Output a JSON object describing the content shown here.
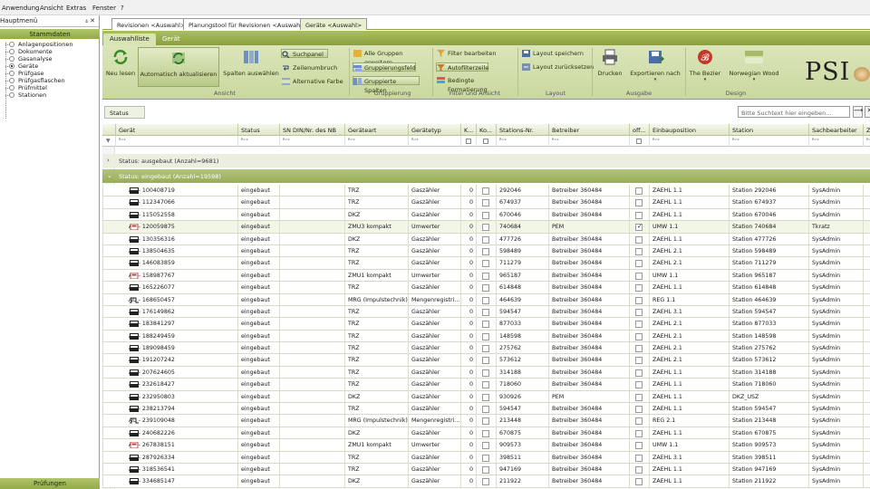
{
  "menu": [
    "Anwendung",
    "Ansicht",
    "Extras",
    "Fenster",
    "?"
  ],
  "left": {
    "title": "Hauptmenü",
    "controls": "₄ ✕",
    "header": "Stammdaten",
    "footer": "Prüfungen",
    "items": [
      {
        "label": "Anlagenpositionen",
        "selected": false
      },
      {
        "label": "Dokumente",
        "selected": false
      },
      {
        "label": "Gasanalyse",
        "selected": false
      },
      {
        "label": "Geräte",
        "selected": true
      },
      {
        "label": "Prüfgase",
        "selected": false
      },
      {
        "label": "Prüfgasflaschen",
        "selected": false
      },
      {
        "label": "Prüfmittel",
        "selected": false
      },
      {
        "label": "Stationen",
        "selected": false
      }
    ]
  },
  "doc_tabs": [
    "Revisionen <Auswahl>",
    "Planungstool für Revisionen <Auswahl>",
    "Geräte <Auswahl>"
  ],
  "ribbon_tabs": [
    "Auswahlliste",
    "Gerät"
  ],
  "ribbon": {
    "neu_lesen": "Neu lesen",
    "auto": "Automatisch aktualisieren",
    "spalten": "Spalten auswählen",
    "suchpanel": "Suchpanel",
    "zeilenumbruch": "Zeilenumbruch",
    "alternative": "Alternative Farbe",
    "alle_gruppen": "Alle Gruppen erweitern",
    "gruppierungsfeld": "Gruppierungsfeld",
    "gruppierte": "Gruppierte Spalten",
    "filter_bearb": "Filter bearbeiten",
    "autofilter": "Autofilterzeile",
    "bedingte": "Bedingte Formatierung",
    "layout_speichern": "Layout speichern",
    "layout_zurueck": "Layout zurücksetzen",
    "drucken": "Drucken",
    "exportieren": "Exportieren nach",
    "bezier": "The Bezier",
    "norwegian": "Norwegian Wood",
    "groups": [
      "Ansicht",
      "Gruppierung",
      "Filter und Ansicht",
      "Layout",
      "Ausgabe",
      "Design"
    ],
    "logo": "PSI"
  },
  "group_panel": {
    "chip": "Status",
    "search_placeholder": "Bitte Suchtext hier eingeben...",
    "btn1": "⟶",
    "btn2": "✕"
  },
  "columns": [
    "Gerät",
    "Status",
    "SN DIN/Nr. des NB",
    "Geräteart",
    "Gerätetyp",
    "K...",
    "Ko...",
    "Stations-Nr.",
    "Betreiber",
    "off...",
    "Einbauposition",
    "Station",
    "Sachbearbeiter",
    "Ze"
  ],
  "filter_marker": "▼",
  "filter_glyph": "ᴿ⁼ᶜ",
  "groups": [
    {
      "label": "Status: ausgebaut (Anzahl=9681)",
      "arrow": "›"
    },
    {
      "label": "Status: eingebaut (Anzahl=19598)",
      "arrow": "⌄"
    }
  ],
  "rows": [
    {
      "icon": "meter",
      "geraet": "AC - 100408719",
      "status": "eingebaut",
      "art": "TRZ",
      "typ": "Gaszähler",
      "k": "0",
      "nr": "292046",
      "betreiber": "Betreiber 360484",
      "off": false,
      "pos": "ZAEHL 1.1",
      "station": "Station 292046",
      "sb": "SysAdmin"
    },
    {
      "icon": "meter",
      "geraet": "AC - 112347066",
      "status": "eingebaut",
      "art": "TRZ",
      "typ": "Gaszähler",
      "k": "0",
      "nr": "674937",
      "betreiber": "Betreiber 360484",
      "off": false,
      "pos": "ZAEHL 1.1",
      "station": "Station 674937",
      "sb": "SysAdmin"
    },
    {
      "icon": "meter",
      "geraet": "AC - 115052558",
      "status": "eingebaut",
      "art": "DKZ",
      "typ": "Gaszähler",
      "k": "0",
      "nr": "670046",
      "betreiber": "Betreiber 360484",
      "off": false,
      "pos": "ZAEHL 1.1",
      "station": "Station 670046",
      "sb": "SysAdmin"
    },
    {
      "icon": "conv",
      "geraet": "AC - 120059875",
      "status": "eingebaut",
      "art": "ZMU3 kompakt",
      "typ": "Umwerter",
      "k": "0",
      "nr": "740684",
      "betreiber": "PEM",
      "off": true,
      "pos": "UMW 1.1",
      "station": "Station 740684",
      "sb": "Tkratz"
    },
    {
      "icon": "meter",
      "geraet": "AC - 130356316",
      "status": "eingebaut",
      "art": "DKZ",
      "typ": "Gaszähler",
      "k": "0",
      "nr": "477726",
      "betreiber": "Betreiber 360484",
      "off": false,
      "pos": "ZAEHL 1.1",
      "station": "Station 477726",
      "sb": "SysAdmin"
    },
    {
      "icon": "meter",
      "geraet": "AC - 138504635",
      "status": "eingebaut",
      "art": "TRZ",
      "typ": "Gaszähler",
      "k": "0",
      "nr": "598489",
      "betreiber": "Betreiber 360484",
      "off": false,
      "pos": "ZAEHL 2.1",
      "station": "Station 598489",
      "sb": "SysAdmin"
    },
    {
      "icon": "meter",
      "geraet": "AC - 146083859",
      "status": "eingebaut",
      "art": "TRZ",
      "typ": "Gaszähler",
      "k": "0",
      "nr": "711279",
      "betreiber": "Betreiber 360484",
      "off": false,
      "pos": "ZAEHL 2.1",
      "station": "Station 711279",
      "sb": "SysAdmin"
    },
    {
      "icon": "conv",
      "geraet": "AC - 158987767",
      "status": "eingebaut",
      "art": "ZMU1 kompakt",
      "typ": "Umwerter",
      "k": "0",
      "nr": "965187",
      "betreiber": "Betreiber 360484",
      "off": false,
      "pos": "UMW 1.1",
      "station": "Station 965187",
      "sb": "SysAdmin"
    },
    {
      "icon": "meter",
      "geraet": "AC - 165226077",
      "status": "eingebaut",
      "art": "TRZ",
      "typ": "Gaszähler",
      "k": "0",
      "nr": "614848",
      "betreiber": "Betreiber 360484",
      "off": false,
      "pos": "ZAEHL 1.1",
      "station": "Station 614848",
      "sb": "SysAdmin"
    },
    {
      "icon": "pulse",
      "geraet": "AC - 168650457",
      "status": "eingebaut",
      "art": "MRG (Impulstechnik)",
      "typ": "Mengenregistri...",
      "k": "0",
      "nr": "464639",
      "betreiber": "Betreiber 360484",
      "off": false,
      "pos": "REG 1.1",
      "station": "Station 464639",
      "sb": "SysAdmin"
    },
    {
      "icon": "meter",
      "geraet": "AC - 176149862",
      "status": "eingebaut",
      "art": "TRZ",
      "typ": "Gaszähler",
      "k": "0",
      "nr": "594547",
      "betreiber": "Betreiber 360484",
      "off": false,
      "pos": "ZAEHL 3.1",
      "station": "Station 594547",
      "sb": "SysAdmin"
    },
    {
      "icon": "meter",
      "geraet": "AC - 183841297",
      "status": "eingebaut",
      "art": "TRZ",
      "typ": "Gaszähler",
      "k": "0",
      "nr": "877033",
      "betreiber": "Betreiber 360484",
      "off": false,
      "pos": "ZAEHL 2.1",
      "station": "Station 877033",
      "sb": "SysAdmin"
    },
    {
      "icon": "meter",
      "geraet": "AC - 188249459",
      "status": "eingebaut",
      "art": "TRZ",
      "typ": "Gaszähler",
      "k": "0",
      "nr": "148598",
      "betreiber": "Betreiber 360484",
      "off": false,
      "pos": "ZAEHL 2.1",
      "station": "Station 148598",
      "sb": "SysAdmin"
    },
    {
      "icon": "meter",
      "geraet": "AC - 189098459",
      "status": "eingebaut",
      "art": "TRZ",
      "typ": "Gaszähler",
      "k": "0",
      "nr": "275762",
      "betreiber": "Betreiber 360484",
      "off": false,
      "pos": "ZAEHL 2.1",
      "station": "Station 275762",
      "sb": "SysAdmin"
    },
    {
      "icon": "meter",
      "geraet": "AC - 191207242",
      "status": "eingebaut",
      "art": "TRZ",
      "typ": "Gaszähler",
      "k": "0",
      "nr": "573612",
      "betreiber": "Betreiber 360484",
      "off": false,
      "pos": "ZAEHL 2.1",
      "station": "Station 573612",
      "sb": "SysAdmin"
    },
    {
      "icon": "meter",
      "geraet": "AC - 207624605",
      "status": "eingebaut",
      "art": "TRZ",
      "typ": "Gaszähler",
      "k": "0",
      "nr": "314188",
      "betreiber": "Betreiber 360484",
      "off": false,
      "pos": "ZAEHL 1.1",
      "station": "Station 314188",
      "sb": "SysAdmin"
    },
    {
      "icon": "meter",
      "geraet": "AC - 232618427",
      "status": "eingebaut",
      "art": "TRZ",
      "typ": "Gaszähler",
      "k": "0",
      "nr": "718060",
      "betreiber": "Betreiber 360484",
      "off": false,
      "pos": "ZAEHL 1.1",
      "station": "Station 718060",
      "sb": "SysAdmin"
    },
    {
      "icon": "meter",
      "geraet": "AC - 232950803",
      "status": "eingebaut",
      "art": "DKZ",
      "typ": "Gaszähler",
      "k": "0",
      "nr": "930926",
      "betreiber": "PEM",
      "off": false,
      "pos": "ZAEHL 1.1",
      "station": "DKZ_USZ",
      "sb": "SysAdmin"
    },
    {
      "icon": "meter",
      "geraet": "AC - 238213794",
      "status": "eingebaut",
      "art": "TRZ",
      "typ": "Gaszähler",
      "k": "0",
      "nr": "594547",
      "betreiber": "Betreiber 360484",
      "off": false,
      "pos": "ZAEHL 1.1",
      "station": "Station 594547",
      "sb": "SysAdmin"
    },
    {
      "icon": "pulse",
      "geraet": "AC - 239109048",
      "status": "eingebaut",
      "art": "MRG (Impulstechnik)",
      "typ": "Mengenregistri...",
      "k": "0",
      "nr": "213448",
      "betreiber": "Betreiber 360484",
      "off": false,
      "pos": "REG 2.1",
      "station": "Station 213448",
      "sb": "SysAdmin"
    },
    {
      "icon": "meter",
      "geraet": "AC - 240682226",
      "status": "eingebaut",
      "art": "DKZ",
      "typ": "Gaszähler",
      "k": "0",
      "nr": "670875",
      "betreiber": "Betreiber 360484",
      "off": false,
      "pos": "ZAEHL 1.1",
      "station": "Station 670875",
      "sb": "SysAdmin"
    },
    {
      "icon": "conv",
      "geraet": "AC - 267838151",
      "status": "eingebaut",
      "art": "ZMU1 kompakt",
      "typ": "Umwerter",
      "k": "0",
      "nr": "909573",
      "betreiber": "Betreiber 360484",
      "off": false,
      "pos": "UMW 1.1",
      "station": "Station 909573",
      "sb": "SysAdmin"
    },
    {
      "icon": "meter",
      "geraet": "AC - 287926334",
      "status": "eingebaut",
      "art": "TRZ",
      "typ": "Gaszähler",
      "k": "0",
      "nr": "398511",
      "betreiber": "Betreiber 360484",
      "off": false,
      "pos": "ZAEHL 3.1",
      "station": "Station 398511",
      "sb": "SysAdmin"
    },
    {
      "icon": "meter",
      "geraet": "AC - 318536541",
      "status": "eingebaut",
      "art": "TRZ",
      "typ": "Gaszähler",
      "k": "0",
      "nr": "947169",
      "betreiber": "Betreiber 360484",
      "off": false,
      "pos": "ZAEHL 1.1",
      "station": "Station 947169",
      "sb": "SysAdmin"
    },
    {
      "icon": "meter",
      "geraet": "AC - 334685147",
      "status": "eingebaut",
      "art": "DKZ",
      "typ": "Gaszähler",
      "k": "0",
      "nr": "211922",
      "betreiber": "Betreiber 360484",
      "off": false,
      "pos": "ZAEHL 1.1",
      "station": "Station 211922",
      "sb": "SysAdmin"
    }
  ],
  "colors": {
    "accent": "#8aa040",
    "accent_light": "#dbe5b9"
  }
}
